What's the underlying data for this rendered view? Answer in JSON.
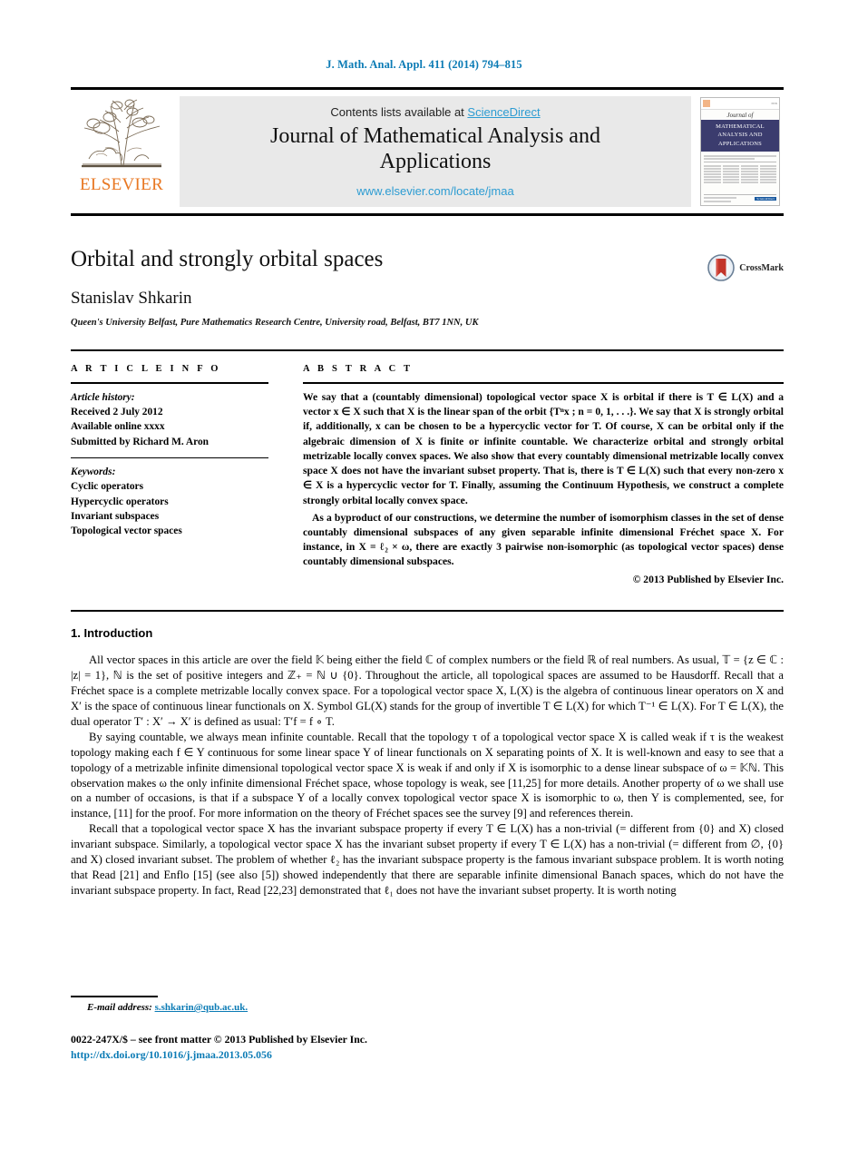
{
  "running_head": "J. Math. Anal. Appl. 411 (2014) 794–815",
  "masthead": {
    "publisher_name": "ELSEVIER",
    "contents_prefix": "Contents lists available at ",
    "contents_link": "ScienceDirect",
    "journal_title": "Journal of Mathematical Analysis and Applications",
    "journal_url": "www.elsevier.com/locate/jmaa",
    "cover": {
      "script_line": "Journal of",
      "navy_line1": "MATHEMATICAL",
      "navy_line2": "ANALYSIS AND",
      "navy_line3": "APPLICATIONS",
      "sciencedirect_badge": "ScienceDirect"
    }
  },
  "title_block": {
    "title": "Orbital and strongly orbital spaces",
    "author": "Stanislav Shkarin",
    "affiliation": "Queen's University Belfast, Pure Mathematics Research Centre, University road, Belfast, BT7 1NN, UK",
    "crossmark_label": "CrossMark"
  },
  "article_info": {
    "heading": "A R T I C L E   I N F O",
    "history_label": "Article history:",
    "history_lines": [
      "Received 2 July 2012",
      "Available online xxxx",
      "Submitted by Richard M. Aron"
    ],
    "keywords_label": "Keywords:",
    "keywords": [
      "Cyclic operators",
      "Hypercyclic operators",
      "Invariant subspaces",
      "Topological vector spaces"
    ]
  },
  "abstract": {
    "heading": "A B S T R A C T",
    "paragraph1": "We say that a (countably dimensional) topological vector space X is orbital if there is T ∈ L(X) and a vector x ∈ X such that X is the linear span of the orbit {Tⁿx ; n = 0, 1, . . .}. We say that X is strongly orbital if, additionally, x can be chosen to be a hypercyclic vector for T. Of course, X can be orbital only if the algebraic dimension of X is finite or infinite countable. We characterize orbital and strongly orbital metrizable locally convex spaces. We also show that every countably dimensional metrizable locally convex space X does not have the invariant subset property. That is, there is T ∈ L(X) such that every non-zero x ∈ X is a hypercyclic vector for T. Finally, assuming the Continuum Hypothesis, we construct a complete strongly orbital locally convex space.",
    "paragraph2": "As a byproduct of our constructions, we determine the number of isomorphism classes in the set of dense countably dimensional subspaces of any given separable infinite dimensional Fréchet space X. For instance, in X = ℓ₂ × ω, there are exactly 3 pairwise non-isomorphic (as topological vector spaces) dense countably dimensional subspaces.",
    "copyright": "© 2013 Published by Elsevier Inc."
  },
  "body": {
    "section_title": "1. Introduction",
    "paragraph1": "All vector spaces in this article are over the field 𝕂 being either the field ℂ of complex numbers or the field ℝ of real numbers. As usual, 𝕋 = {z ∈ ℂ : |z| = 1}, ℕ is the set of positive integers and ℤ₊ = ℕ ∪ {0}. Throughout the article, all topological spaces are assumed to be Hausdorff. Recall that a Fréchet space is a complete metrizable locally convex space. For a topological vector space X, L(X) is the algebra of continuous linear operators on X and X′ is the space of continuous linear functionals on X. Symbol GL(X) stands for the group of invertible T ∈ L(X) for which T⁻¹ ∈ L(X). For T ∈ L(X), the dual operator T′ : X′ → X′ is defined as usual: T′f = f ∘ T.",
    "paragraph2": "By saying countable, we always mean infinite countable. Recall that the topology τ of a topological vector space X is called weak if τ is the weakest topology making each f ∈ Y continuous for some linear space Y of linear functionals on X separating points of X. It is well-known and easy to see that a topology of a metrizable infinite dimensional topological vector space X is weak if and only if X is isomorphic to a dense linear subspace of ω = 𝕂ℕ. This observation makes ω the only infinite dimensional Fréchet space, whose topology is weak, see [11,25] for more details. Another property of ω we shall use on a number of occasions, is that if a subspace Y of a locally convex topological vector space X is isomorphic to ω, then Y is complemented, see, for instance, [11] for the proof. For more information on the theory of Fréchet spaces see the survey [9] and references therein.",
    "paragraph3": "Recall that a topological vector space X has the invariant subspace property if every T ∈ L(X) has a non-trivial (= different from {0} and X) closed invariant subspace. Similarly, a topological vector space X has the invariant subset property if every T ∈ L(X) has a non-trivial (= different from ∅, {0} and X) closed invariant subset. The problem of whether ℓ₂ has the invariant subspace property is the famous invariant subspace problem. It is worth noting that Read [21] and Enflo [15] (see also [5]) showed independently that there are separable infinite dimensional Banach spaces, which do not have the invariant subspace property. In fact, Read [22,23] demonstrated that ℓ₁ does not have the invariant subset property. It is worth noting"
  },
  "footer": {
    "email_label": "E-mail address:",
    "email": "s.shkarin@qub.ac.uk.",
    "issn_line": "0022-247X/$ – see front matter © 2013 Published by Elsevier Inc.",
    "doi": "http://dx.doi.org/10.1016/j.jmaa.2013.05.056"
  },
  "colors": {
    "link_blue": "#0b7bb5",
    "sciencedirect_blue": "#2d9cd2",
    "elsevier_orange": "#E87722",
    "cover_navy": "#3b3c6e"
  }
}
